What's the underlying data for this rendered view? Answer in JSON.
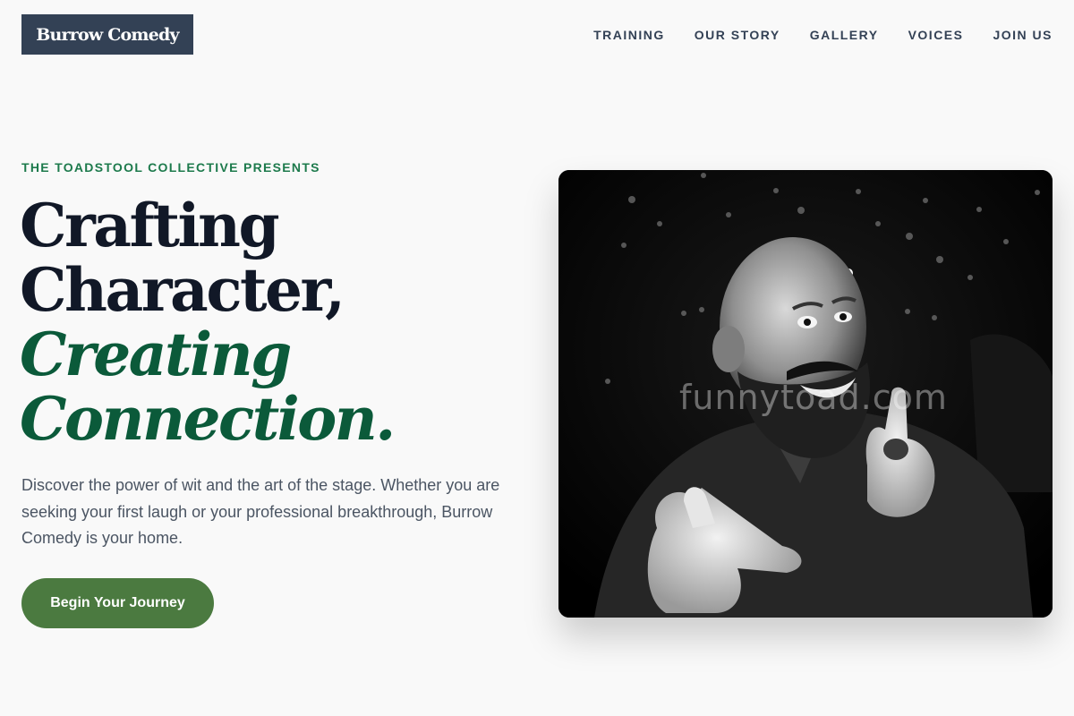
{
  "brand": {
    "logo_text": "Burrow Comedy"
  },
  "nav": {
    "items": [
      "TRAINING",
      "OUR STORY",
      "GALLERY",
      "VOICES",
      "JOIN US"
    ]
  },
  "hero": {
    "eyebrow": "THE TOADSTOOL COLLECTIVE PRESENTS",
    "headline_line1": "Crafting",
    "headline_line2": "Character,",
    "headline_line3": "Creating",
    "headline_line4": "Connection.",
    "lead": "Discover the power of wit and the art of the stage. Whether you are seeking your first laugh or your professional breakthrough, Burrow Comedy is your home.",
    "cta_label": "Begin Your Journey",
    "image_watermark": "funnytoad.com"
  },
  "colors": {
    "logo_bg": "#334155",
    "eyebrow": "#1d7a4c",
    "headline": "#111827",
    "accent": "#0b5a3a",
    "cta_bg": "#4b7a40",
    "page_bg": "#f9f9f9"
  }
}
